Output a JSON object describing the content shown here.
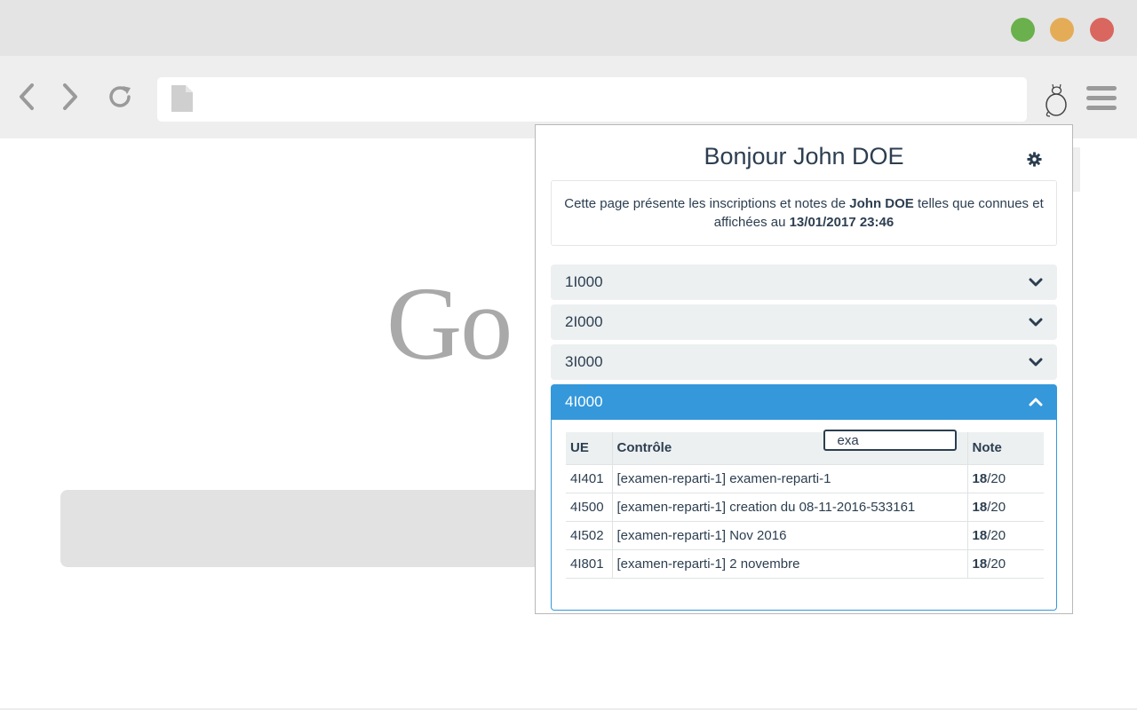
{
  "popup": {
    "title": "Bonjour John DOE",
    "info": {
      "prefix": "Cette page présente les inscriptions et notes de",
      "name": "John DOE",
      "middle": "telles que connues et affichées au",
      "datetime": "13/01/2017 23:46"
    },
    "panels": [
      {
        "label": "1I000",
        "expanded": false
      },
      {
        "label": "2I000",
        "expanded": false
      },
      {
        "label": "3I000",
        "expanded": false
      },
      {
        "label": "4I000",
        "expanded": true
      }
    ],
    "table": {
      "headers": {
        "ue": "UE",
        "controle": "Contrôle",
        "note": "Note"
      },
      "filter_value": "exa",
      "rows": [
        {
          "ue": "4I401",
          "controle": "[examen-reparti-1] examen-reparti-1",
          "note": "18",
          "max": "/20"
        },
        {
          "ue": "4I500",
          "controle": "[examen-reparti-1] creation du 08-11-2016-533161",
          "note": "18",
          "max": "/20"
        },
        {
          "ue": "4I502",
          "controle": "[examen-reparti-1] Nov 2016",
          "note": "18",
          "max": "/20"
        },
        {
          "ue": "4I801",
          "controle": "[examen-reparti-1] 2 novembre",
          "note": "18",
          "max": "/20"
        }
      ]
    }
  },
  "background_page": {
    "logo_text": "Go"
  },
  "colors": {
    "accent": "#3498db",
    "text": "#2c3e50",
    "panel_bg": "#ecf0f1",
    "traffic_green": "#6ab04c",
    "traffic_yellow": "#e5ac58",
    "traffic_red": "#d9675f"
  }
}
